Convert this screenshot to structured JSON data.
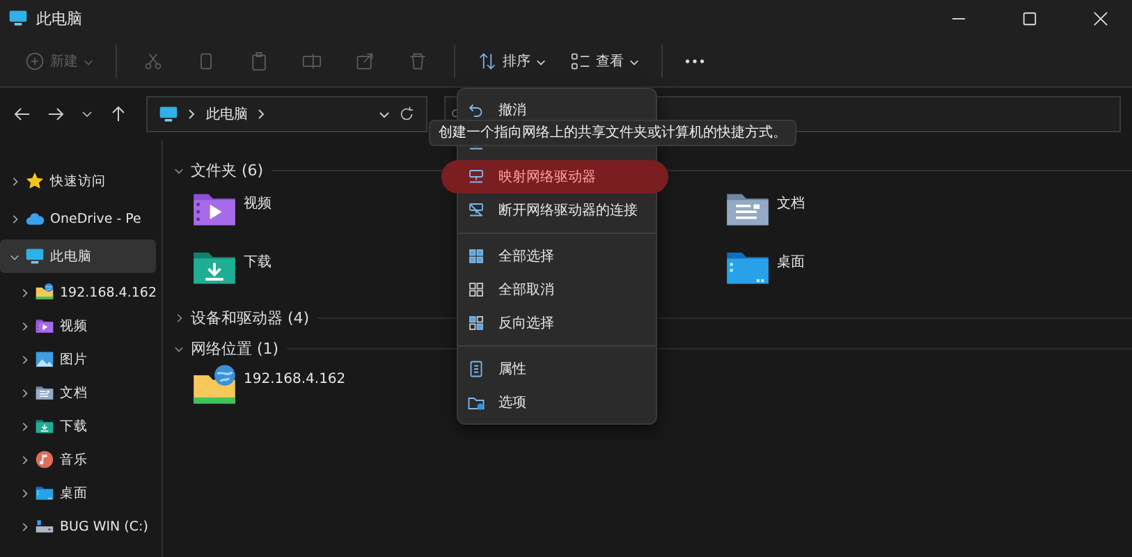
{
  "window": {
    "title": "此电脑"
  },
  "toolbar": {
    "new": {
      "label": "新建",
      "disabled": true
    },
    "actions": [
      {
        "kind": "cut",
        "disabled": true
      },
      {
        "kind": "copy",
        "disabled": true
      },
      {
        "kind": "paste",
        "disabled": true
      },
      {
        "kind": "rename",
        "disabled": true
      },
      {
        "kind": "share",
        "disabled": true
      },
      {
        "kind": "delete",
        "disabled": true
      }
    ],
    "sort": {
      "label": "排序"
    },
    "view": {
      "label": "查看"
    }
  },
  "address": {
    "path": [
      "此电脑"
    ]
  },
  "sidebar": {
    "items": [
      {
        "label": "快速访问",
        "kind": "star",
        "expanded": false,
        "selected": false
      },
      {
        "label": "OneDrive - Pe",
        "kind": "cloud",
        "expanded": false,
        "selected": false
      },
      {
        "label": "此电脑",
        "kind": "pc",
        "expanded": true,
        "selected": true,
        "children": [
          {
            "label": "192.168.4.162",
            "kind": "netfolder",
            "expanded": false,
            "selected": false
          },
          {
            "label": "视频",
            "kind": "video",
            "expanded": false,
            "selected": false
          },
          {
            "label": "图片",
            "kind": "pictures",
            "expanded": false,
            "selected": false
          },
          {
            "label": "文档",
            "kind": "documents",
            "expanded": false,
            "selected": false
          },
          {
            "label": "下载",
            "kind": "downloads",
            "expanded": false,
            "selected": false
          },
          {
            "label": "音乐",
            "kind": "music",
            "expanded": false,
            "selected": false
          },
          {
            "label": "桌面",
            "kind": "desktop",
            "expanded": false,
            "selected": false
          },
          {
            "label": "BUG WIN (C:)",
            "kind": "drive",
            "expanded": false,
            "selected": false
          }
        ]
      }
    ]
  },
  "sections": [
    {
      "title": "文件夹 (6)",
      "expanded": true,
      "items": [
        {
          "label": "视频",
          "kind": "video"
        },
        {
          "label": "文档",
          "kind": "documents"
        },
        {
          "label": "下载",
          "kind": "downloads"
        },
        {
          "label": "桌面",
          "kind": "desktop"
        }
      ]
    },
    {
      "title": "设备和驱动器 (4)",
      "expanded": false
    },
    {
      "title": "网络位置 (1)",
      "expanded": true,
      "items": [
        {
          "label": "192.168.4.162",
          "kind": "netfolder"
        }
      ]
    }
  ],
  "context_menu": {
    "groups": [
      [
        {
          "label": "撤消",
          "kind": "undo",
          "selected": false
        },
        {
          "kind": "add-location",
          "selected": false
        },
        {
          "label": "映射网络驱动器",
          "kind": "map-drive",
          "selected": true
        },
        {
          "label": "断开网络驱动器的连接",
          "kind": "disconnect",
          "selected": false
        }
      ],
      [
        {
          "label": "全部选择",
          "kind": "select-all",
          "selected": false
        },
        {
          "label": "全部取消",
          "kind": "select-none",
          "selected": false
        },
        {
          "label": "反向选择",
          "kind": "invert",
          "selected": false
        }
      ],
      [
        {
          "label": "属性",
          "kind": "properties",
          "selected": false
        },
        {
          "label": "选项",
          "kind": "options",
          "selected": false
        }
      ]
    ]
  },
  "tooltip": {
    "text": "创建一个指向网络上的共享文件夹或计算机的快捷方式。"
  }
}
